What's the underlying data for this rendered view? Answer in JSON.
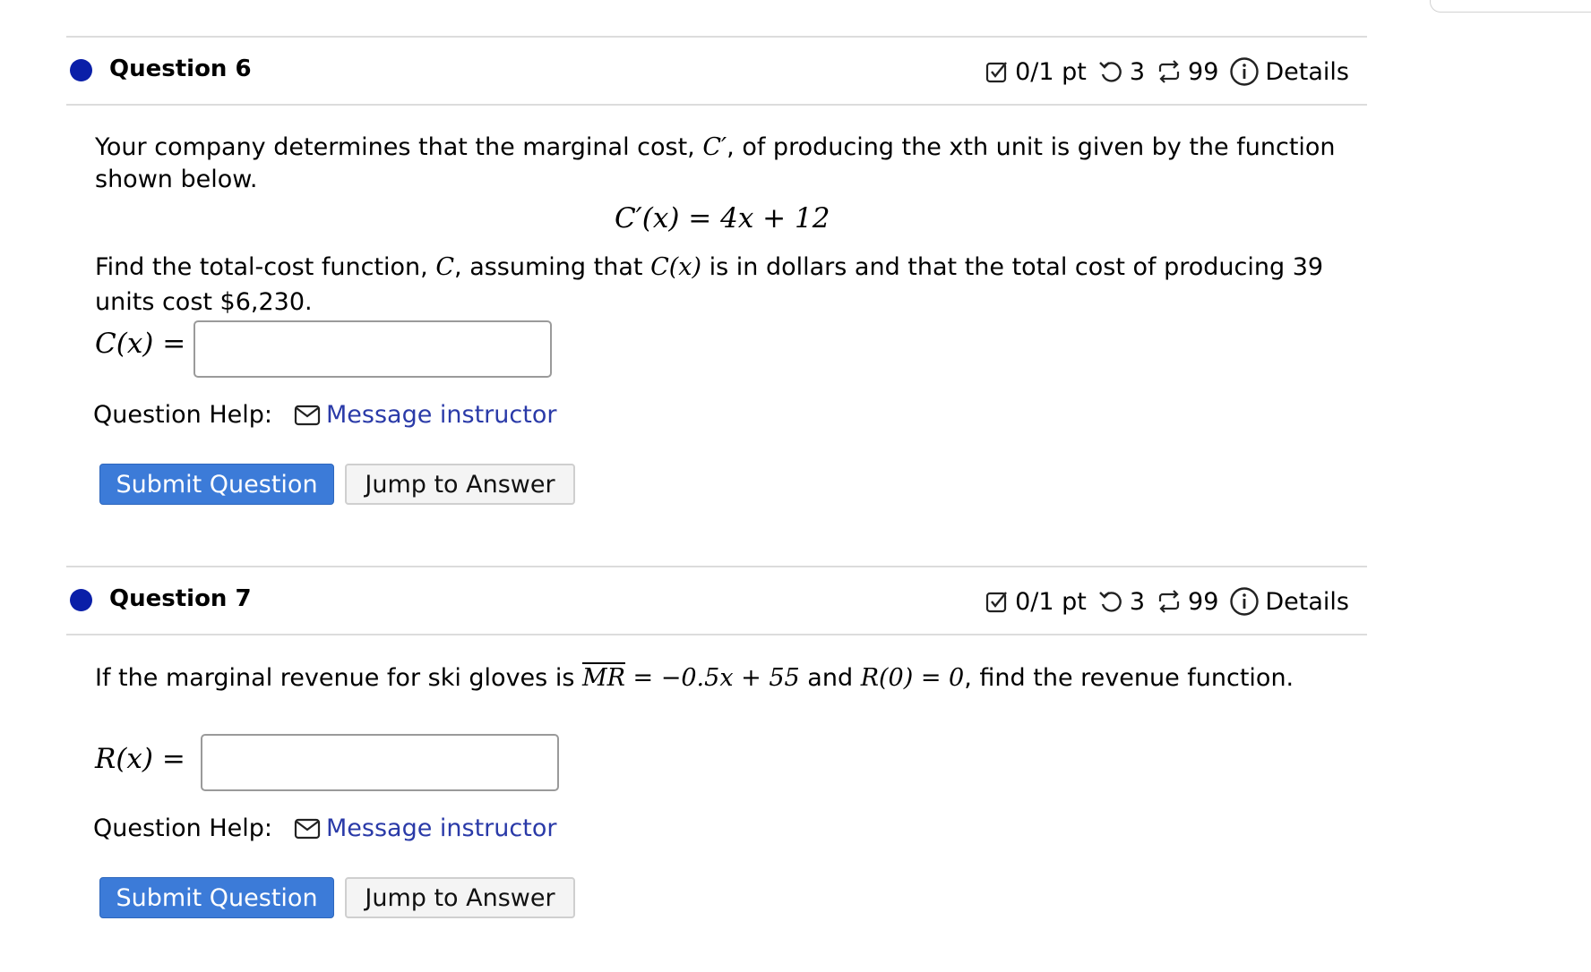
{
  "questions": [
    {
      "title": "Question 6",
      "score": "0/1 pt",
      "retries": "3",
      "attempts": "99",
      "details_label": "Details",
      "text_1": "Your company determines that the marginal cost,",
      "text_1_sym": "C′",
      "text_1b": ", of producing the xth unit is given by the function",
      "text_2": "shown below.",
      "formula": "C′(x) = 4x + 12",
      "text_3a": "Find the total-cost function,",
      "text_3_sym": "C",
      "text_3b": ", assuming that",
      "text_3_sym2": "C(x)",
      "text_3c": "is in dollars and that the total cost of producing 39",
      "text_4": "units cost $6,230.",
      "answer_label": "C(x) =",
      "answer_value": "",
      "help_label": "Question Help:",
      "help_link": "Message instructor",
      "submit_label": "Submit Question",
      "jump_label": "Jump to Answer"
    },
    {
      "title": "Question 7",
      "score": "0/1 pt",
      "retries": "3",
      "attempts": "99",
      "details_label": "Details",
      "text_1a": "If the marginal revenue for ski gloves is",
      "text_1_mr": "MR",
      "text_1_eq": " = −0.5x + 55",
      "text_1b": "and",
      "text_1_r0": "R(0) = 0",
      "text_1c": ", find the revenue function.",
      "answer_label": "R(x) =",
      "answer_value": "",
      "help_label": "Question Help:",
      "help_link": "Message instructor",
      "submit_label": "Submit Question",
      "jump_label": "Jump to Answer"
    }
  ],
  "colors": {
    "status_dot": "#0a1fa8",
    "primary_button": "#3c7bd8",
    "link": "#2a3aa8"
  }
}
